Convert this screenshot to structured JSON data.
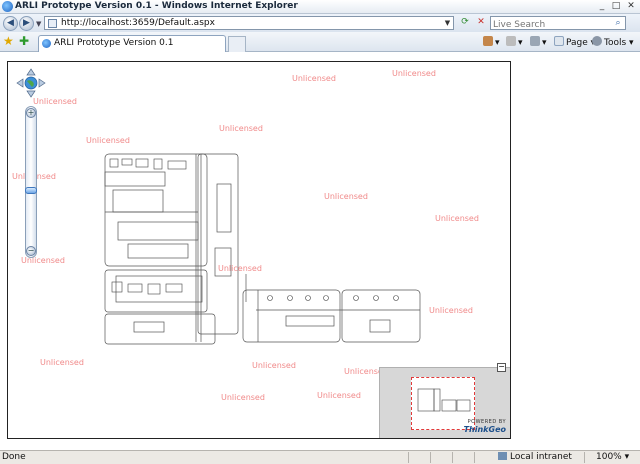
{
  "window": {
    "title": "ARLI Prototype Version 0.1 - Windows Internet Explorer",
    "minimize": "_",
    "maximize": "□",
    "close": "✕"
  },
  "address": {
    "url": "http://localhost:3659/Default.aspx",
    "search_placeholder": "Live Search"
  },
  "tabs": [
    {
      "label": "ARLI Prototype Version 0.1"
    }
  ],
  "commands": {
    "page": "Page",
    "tools": "Tools"
  },
  "map": {
    "watermark": "Unlicensed",
    "overview_powered": "POWERED BY",
    "overview_brand": "ThinkGeo",
    "overview_toggle": "−"
  },
  "status": {
    "text": "Done",
    "zone": "Local intranet",
    "zoom": "100%"
  },
  "colors": {
    "watermark": "#f08a8a",
    "overview_frame": "#e23a3a",
    "brand": "#1b4e8a"
  }
}
